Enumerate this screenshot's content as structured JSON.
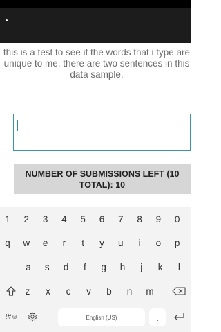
{
  "prompt_text": "this is a test to see if the words that i type are unique to me. there are two sentences in this data sample.",
  "input": {
    "value": ""
  },
  "submit_label": "NUMBER OF SUBMISSIONS LEFT (10 TOTAL): 10",
  "keyboard": {
    "row1": [
      "1",
      "2",
      "3",
      "4",
      "5",
      "6",
      "7",
      "8",
      "9",
      "0"
    ],
    "row2": [
      "q",
      "w",
      "e",
      "r",
      "t",
      "y",
      "u",
      "i",
      "o",
      "p"
    ],
    "row3": [
      "a",
      "s",
      "d",
      "f",
      "g",
      "h",
      "j",
      "k",
      "l"
    ],
    "row4": [
      "z",
      "x",
      "c",
      "v",
      "b",
      "n",
      "m"
    ],
    "symbols_label": "!#☺",
    "space_label": "English (US)",
    "period_label": ".",
    "icons": {
      "shift": "shift-icon",
      "backspace": "backspace-icon",
      "settings": "gear-icon",
      "enter": "enter-icon"
    }
  },
  "colors": {
    "input_border": "#3a94b0",
    "submit_bg": "#d6d6d6",
    "keyboard_bg": "#f3f3f3",
    "app_bar": "#1c1c1c"
  }
}
